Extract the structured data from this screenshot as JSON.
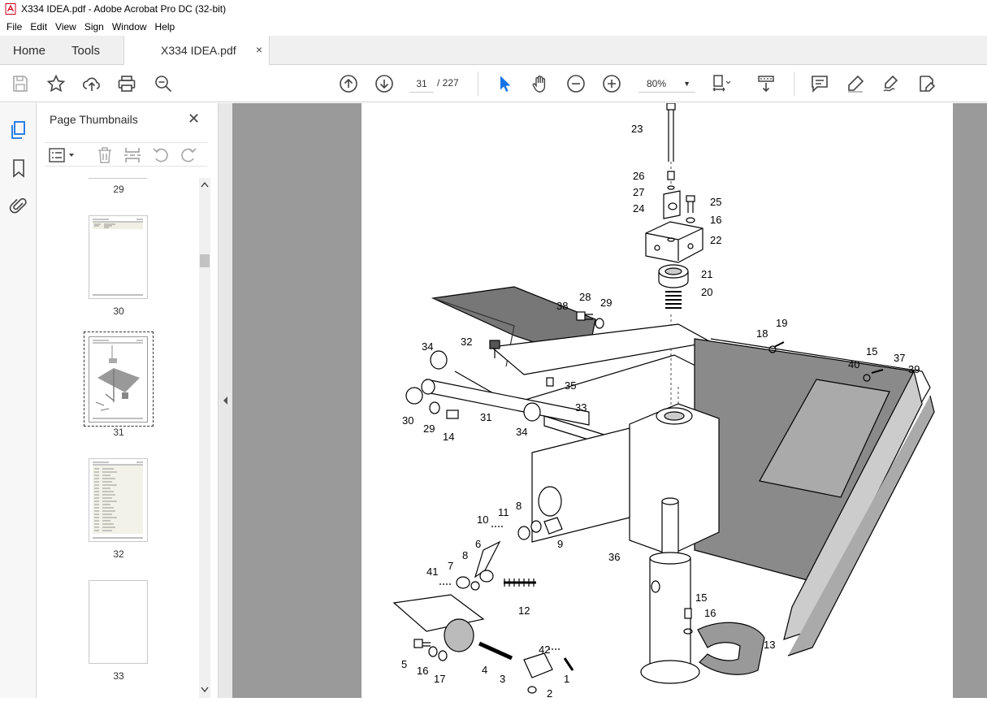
{
  "window": {
    "title": "X334 IDEA.pdf - Adobe Acrobat Pro DC (32-bit)"
  },
  "menu": [
    "File",
    "Edit",
    "View",
    "Sign",
    "Window",
    "Help"
  ],
  "tabs": {
    "home": "Home",
    "tools": "Tools",
    "document": "X334 IDEA.pdf",
    "close": "×"
  },
  "toolbar": {
    "current_page": "31",
    "total_pages": "/ 227",
    "zoom": "80%"
  },
  "panel": {
    "title": "Page Thumbnails",
    "thumbnails": [
      {
        "page": "29"
      },
      {
        "page": "30"
      },
      {
        "page": "31"
      },
      {
        "page": "32"
      },
      {
        "page": "33"
      }
    ]
  },
  "drawing": {
    "callouts": [
      "23",
      "26",
      "27",
      "24",
      "25",
      "16",
      "22",
      "21",
      "20",
      "28",
      "29",
      "38",
      "19",
      "18",
      "32",
      "34",
      "15",
      "37",
      "40",
      "39",
      "35",
      "30",
      "29",
      "14",
      "31",
      "33",
      "34",
      "8",
      "11",
      "10",
      "9",
      "6",
      "36",
      "7",
      "8",
      "41",
      "12",
      "15",
      "16",
      "13",
      "42",
      "5",
      "16",
      "17",
      "4",
      "3",
      "1",
      "2"
    ]
  },
  "colors": {
    "accent": "#1473e6",
    "panel_bg": "#f7f7f7",
    "viewer_bg": "#9a9a9a"
  }
}
